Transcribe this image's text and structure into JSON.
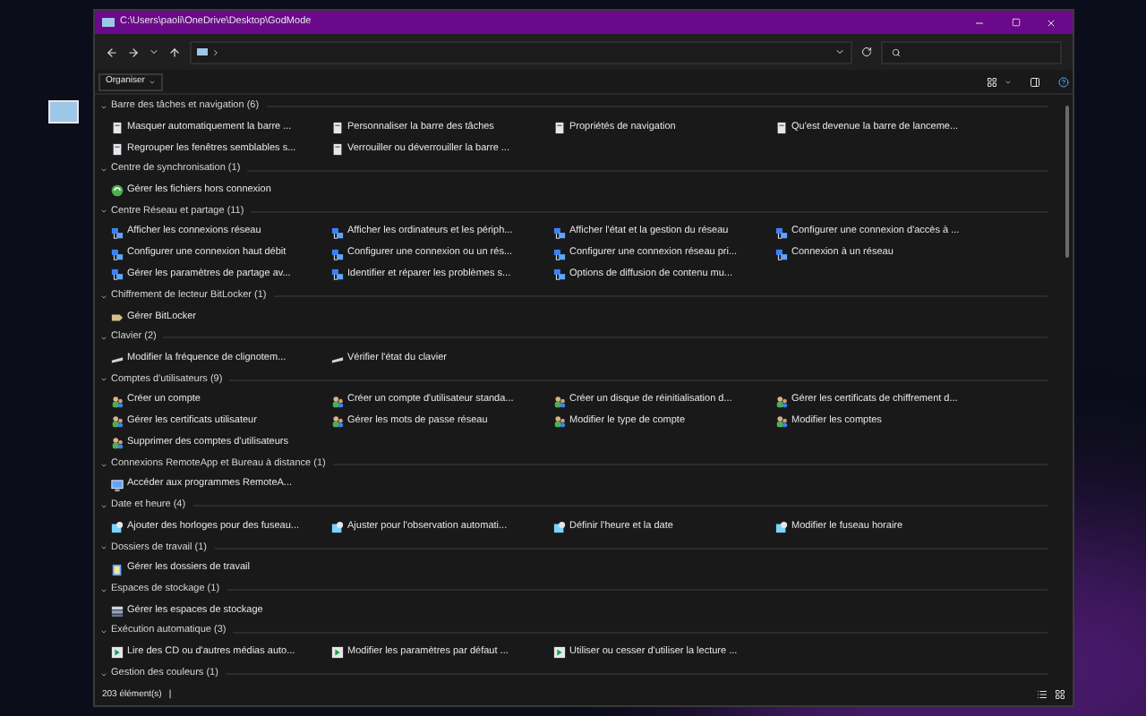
{
  "window": {
    "title": "C:\\Users\\paoli\\OneDrive\\Desktop\\GodMode"
  },
  "toolbar": {
    "organize": "Organiser"
  },
  "groups": [
    {
      "title": "Barre des tâches et navigation (6)",
      "expanded": true,
      "items": [
        {
          "label": "Masquer automatiquement la barre ...",
          "kind": "document"
        },
        {
          "label": "Personnaliser la barre des tâches",
          "kind": "document"
        },
        {
          "label": "Propriétés de navigation",
          "kind": "document"
        },
        {
          "label": "Qu'est devenue la barre de lanceme...",
          "kind": "document"
        },
        {
          "label": "Regrouper les fenêtres semblables s...",
          "kind": "document"
        },
        {
          "label": "Verrouiller ou déverrouiller la barre ...",
          "kind": "document"
        }
      ]
    },
    {
      "title": "Centre de synchronisation (1)",
      "expanded": true,
      "items": [
        {
          "label": "Gérer les fichiers hors connexion",
          "kind": "sync"
        }
      ]
    },
    {
      "title": "Centre Réseau et partage (11)",
      "expanded": true,
      "items": [
        {
          "label": "Afficher les connexions réseau",
          "kind": "network"
        },
        {
          "label": "Afficher les ordinateurs et les périph...",
          "kind": "network"
        },
        {
          "label": "Afficher l'état et la gestion du réseau",
          "kind": "network"
        },
        {
          "label": "Configurer une connexion d'accès à ...",
          "kind": "network"
        },
        {
          "label": "Configurer une connexion haut débit",
          "kind": "network"
        },
        {
          "label": "Configurer une connexion ou un rés...",
          "kind": "network"
        },
        {
          "label": "Configurer une connexion réseau pri...",
          "kind": "network"
        },
        {
          "label": "Connexion à un réseau",
          "kind": "network"
        },
        {
          "label": "Gérer les paramètres de partage av...",
          "kind": "network"
        },
        {
          "label": "Identifier et réparer les problèmes s...",
          "kind": "network"
        },
        {
          "label": "Options de diffusion de contenu mu...",
          "kind": "network"
        }
      ]
    },
    {
      "title": "Chiffrement de lecteur BitLocker (1)",
      "expanded": true,
      "items": [
        {
          "label": "Gérer BitLocker",
          "kind": "key"
        }
      ]
    },
    {
      "title": "Clavier (2)",
      "expanded": true,
      "items": [
        {
          "label": "Modifier la fréquence de clignotem...",
          "kind": "keyboard"
        },
        {
          "label": "Vérifier l'état du clavier",
          "kind": "keyboard"
        }
      ]
    },
    {
      "title": "Comptes d'utilisateurs (9)",
      "expanded": true,
      "items": [
        {
          "label": "Créer un compte",
          "kind": "users"
        },
        {
          "label": "Créer un compte d'utilisateur standa...",
          "kind": "users"
        },
        {
          "label": "Créer un disque de réinitialisation d...",
          "kind": "users"
        },
        {
          "label": "Gérer les certificats de chiffrement d...",
          "kind": "users"
        },
        {
          "label": "Gérer les certificats utilisateur",
          "kind": "users"
        },
        {
          "label": "Gérer les mots de passe réseau",
          "kind": "users"
        },
        {
          "label": "Modifier le type de compte",
          "kind": "users"
        },
        {
          "label": "Modifier les comptes",
          "kind": "users"
        },
        {
          "label": "Supprimer des comptes d'utilisateurs",
          "kind": "users"
        }
      ]
    },
    {
      "title": "Connexions RemoteApp et Bureau à distance (1)",
      "expanded": true,
      "items": [
        {
          "label": "Accéder aux programmes RemoteA...",
          "kind": "remote"
        }
      ]
    },
    {
      "title": "Date et heure (4)",
      "expanded": true,
      "items": [
        {
          "label": "Ajouter des horloges pour des fuseau...",
          "kind": "clock"
        },
        {
          "label": "Ajuster pour l'observation automati...",
          "kind": "clock"
        },
        {
          "label": "Définir l'heure et la date",
          "kind": "clock"
        },
        {
          "label": "Modifier le fuseau horaire",
          "kind": "clock"
        }
      ]
    },
    {
      "title": "Dossiers de travail (1)",
      "expanded": true,
      "items": [
        {
          "label": "Gérer les dossiers de travail",
          "kind": "folder"
        }
      ]
    },
    {
      "title": "Espaces de stockage (1)",
      "expanded": true,
      "items": [
        {
          "label": "Gérer les espaces de stockage",
          "kind": "storage"
        }
      ]
    },
    {
      "title": "Exécution automatique (3)",
      "expanded": true,
      "items": [
        {
          "label": "Lire des CD ou d'autres médias auto...",
          "kind": "autoplay"
        },
        {
          "label": "Modifier les paramètres par défaut ...",
          "kind": "autoplay"
        },
        {
          "label": "Utiliser ou cesser d'utiliser la lecture ...",
          "kind": "autoplay"
        }
      ]
    },
    {
      "title": "Gestion des couleurs (1)",
      "expanded": true
    }
  ],
  "status_bar": {
    "count": "203 élément(s)",
    "separator": "|"
  }
}
